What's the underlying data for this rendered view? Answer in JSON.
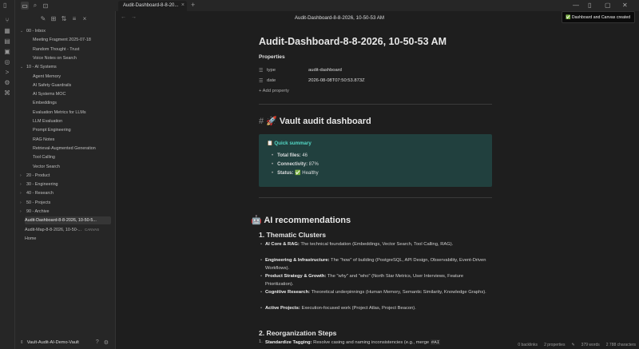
{
  "ribbon": {
    "icons": [
      "files-icon",
      "graph-icon",
      "calendar-icon",
      "template-icon",
      "canvas-icon",
      "terminal-icon",
      "plugin-icon",
      "command-icon"
    ]
  },
  "sidebar_head": {
    "icons": [
      "folder-icon",
      "search-icon",
      "bookmark-icon"
    ],
    "collapse_icon": "sidebar-toggle-icon"
  },
  "tab": {
    "label": "Audit-Dashboard-8-8-20...",
    "close": "×"
  },
  "title_bar": {
    "doc_title": "Audit-Dashboard-8-8-2026, 10-50-53 AM"
  },
  "toast": {
    "text": "✅ Dashboard and Canvas created"
  },
  "sidebar": {
    "tree": [
      {
        "label": "00 - Inbox",
        "depth": 0,
        "folder": true,
        "open": true
      },
      {
        "label": "Meeting Fragment 2025-07-18",
        "depth": 1
      },
      {
        "label": "Random Thought - Trust",
        "depth": 1
      },
      {
        "label": "Voice Notes on Search",
        "depth": 1
      },
      {
        "label": "10 - AI Systems",
        "depth": 0,
        "folder": true,
        "open": true
      },
      {
        "label": "Agent Memory",
        "depth": 1
      },
      {
        "label": "AI Safety Guardrails",
        "depth": 1
      },
      {
        "label": "AI Systems MOC",
        "depth": 1
      },
      {
        "label": "Embeddings",
        "depth": 1
      },
      {
        "label": "Evaluation Metrics for LLMs",
        "depth": 1
      },
      {
        "label": "LLM Evaluation",
        "depth": 1
      },
      {
        "label": "Prompt Engineering",
        "depth": 1
      },
      {
        "label": "RAG Notes",
        "depth": 1
      },
      {
        "label": "Retrieval-Augmented Generation",
        "depth": 1
      },
      {
        "label": "Tool Calling",
        "depth": 1
      },
      {
        "label": "Vector Search",
        "depth": 1
      },
      {
        "label": "20 - Product",
        "depth": 0,
        "folder": true,
        "open": false
      },
      {
        "label": "30 - Engineering",
        "depth": 0,
        "folder": true,
        "open": false
      },
      {
        "label": "40 - Research",
        "depth": 0,
        "folder": true,
        "open": false
      },
      {
        "label": "50 - Projects",
        "depth": 0,
        "folder": true,
        "open": false
      },
      {
        "label": "90 - Archive",
        "depth": 0,
        "folder": true,
        "open": false
      },
      {
        "label": "Audit-Dashboard-8-8-2026, 10-50-5...",
        "depth": 0,
        "selected": true
      },
      {
        "label": "Audit-Map-8-8-2026, 10-50-...",
        "depth": 0,
        "ext": "CANVAS"
      },
      {
        "label": "Home",
        "depth": 0
      }
    ],
    "vault_name": "Vault-Audit-AI-Demo-Vault"
  },
  "note": {
    "title": "Audit-Dashboard-8-8-2026, 10-50-53 AM",
    "properties_heading": "Properties",
    "properties": [
      {
        "icon": "list-icon",
        "key": "type",
        "value": "audit-dashboard"
      },
      {
        "icon": "list-icon",
        "key": "date",
        "value": "2026-08-08T07:50:53.873Z"
      }
    ],
    "add_property": "+ Add property",
    "heading1": "🚀 Vault audit dashboard",
    "callout_title": "📋 Quick summary",
    "summary": [
      {
        "label": "Total files:",
        "value": "46"
      },
      {
        "label": "Connectivity:",
        "value": "87%"
      },
      {
        "label": "Status:",
        "value": "✅ Healthy"
      }
    ],
    "heading2": "🤖 AI recommendations",
    "section1_title": "1. Thematic Clusters",
    "clusters": [
      {
        "label": "AI Core & RAG:",
        "text": "The technical foundation (Embeddings, Vector Search, Tool Calling, RAG)."
      },
      {
        "label": "Engineering & Infrastructure:",
        "text": "The \"how\" of building (PostgreSQL, API Design, Observability, Event-Driven Workflows)."
      },
      {
        "label": "Product Strategy & Growth:",
        "text": "The \"why\" and \"who\" (North Star Metrics, User Interviews, Feature Prioritization)."
      },
      {
        "label": "Cognitive Research:",
        "text": "Theoretical underpinnings (Human Memory, Semantic Similarity, Knowledge Graphs)."
      },
      {
        "label": "Active Projects:",
        "text": "Execution-focused work (Project Atlas, Project Beacon)."
      }
    ],
    "section2_title": "2. Reorganization Steps",
    "steps": [
      {
        "n": "1.",
        "label": "Standardize Tagging:",
        "text": "Resolve casing and naming inconsistencies (e.g., merge ",
        "code": "#AI"
      }
    ]
  },
  "status_bar": {
    "backlinks": "0 backlinks",
    "properties": "2 properties",
    "words": "379 words",
    "characters": "2 788 characters"
  }
}
